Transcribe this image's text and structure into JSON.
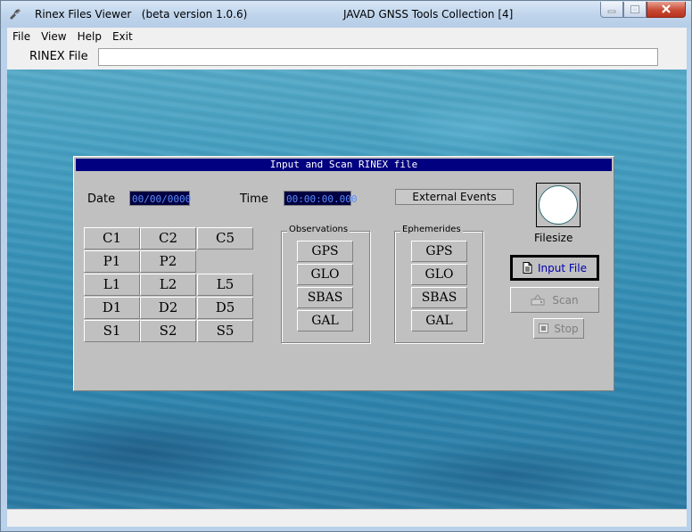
{
  "window": {
    "app_name": "Rinex Files Viewer",
    "version": "(beta version 1.0.6)",
    "collection": "JAVAD GNSS Tools Collection [4]"
  },
  "menu": [
    "File",
    "View",
    "Help",
    "Exit"
  ],
  "toolbar": {
    "rinex_label": "RINEX File",
    "rinex_value": ""
  },
  "panel": {
    "title": "Input and Scan RINEX file",
    "date_label": "Date",
    "date_value": "00/00/0000",
    "time_label": "Time",
    "time_value": "00:00:00.000",
    "external_events": "External Events",
    "filesize_label": "Filesize",
    "signals": [
      [
        "C1",
        "C2",
        "C5"
      ],
      [
        "P1",
        "P2",
        ""
      ],
      [
        "L1",
        "L2",
        "L5"
      ],
      [
        "D1",
        "D2",
        "D5"
      ],
      [
        "S1",
        "S2",
        "S5"
      ]
    ],
    "observations": {
      "title": "Observations",
      "items": [
        "GPS",
        "GLO",
        "SBAS",
        "GAL"
      ]
    },
    "ephemerides": {
      "title": "Ephemerides",
      "items": [
        "GPS",
        "GLO",
        "SBAS",
        "GAL"
      ]
    },
    "buttons": {
      "input_file": "Input File",
      "scan": "Scan",
      "stop": "Stop"
    }
  },
  "icons": {
    "app": "satellite-icon",
    "minimize": "minimize-icon",
    "maximize": "maximize-icon",
    "close": "close-icon",
    "input_file": "document-icon",
    "scan": "scanner-icon",
    "stop": "stop-icon"
  },
  "colors": {
    "panel_title_bg": "#000080",
    "lcd_bg": "#000040",
    "lcd_text": "#5d8cff",
    "panel_bg": "#c0c0c0"
  }
}
